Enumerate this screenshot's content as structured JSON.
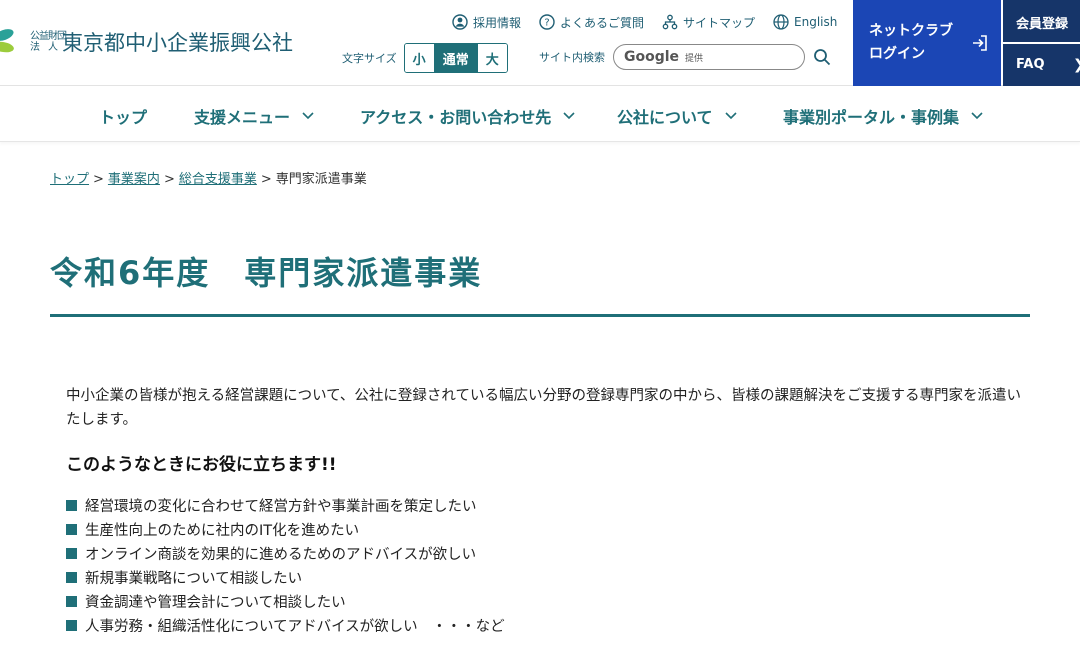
{
  "header": {
    "logo": {
      "corp_type": "公益財団\n法　人",
      "name": "東京都中小企業振興公社"
    },
    "util_links": [
      {
        "label": "採用情報",
        "icon": "person-circle-icon"
      },
      {
        "label": "よくあるご質問",
        "icon": "question-circle-icon"
      },
      {
        "label": "サイトマップ",
        "icon": "sitemap-icon"
      },
      {
        "label": "English",
        "icon": "globe-icon"
      }
    ],
    "font_size": {
      "label": "文字サイズ",
      "options": [
        "小",
        "通常",
        "大"
      ],
      "selected": "通常"
    },
    "search": {
      "label": "サイト内検索",
      "brand": "Google",
      "provided": "提供",
      "icon": "search-icon"
    },
    "netclub": {
      "label": "ネットクラブ\nログイン",
      "icon": "login-icon"
    },
    "member_register": "会員登録",
    "faq": "FAQ"
  },
  "gnav": {
    "items": [
      {
        "label": "トップ"
      },
      {
        "label": "支援メニュー"
      },
      {
        "label": "アクセス・お問い合わせ先"
      },
      {
        "label": "公社について"
      },
      {
        "label": "事業別ポータル・事例集"
      }
    ]
  },
  "breadcrumb": {
    "items": [
      "トップ",
      "事業案内",
      "総合支援事業"
    ],
    "current": "専門家派遣事業",
    "separator": ">"
  },
  "main": {
    "title": "令和6年度　専門家派遣事業",
    "intro": "中小企業の皆様が抱える経営課題について、公社に登録されている幅広い分野の登録専門家の中から、皆様の課題解決をご支援する専門家を派遣いたします。",
    "subheading": "このようなときにお役に立ちます!!",
    "bullets": [
      "経営環境の変化に合わせて経営方針や事業計画を策定したい",
      "生産性向上のために社内のIT化を進めたい",
      "オンライン商談を効果的に進めるためのアドバイスが欲しい",
      "新規事業戦略について相談したい",
      "資金調達や管理会計について相談したい",
      "人事労務・組織活性化についてアドバイスが欲しい　・・・など"
    ]
  },
  "colors": {
    "teal": "#1f6f78",
    "logo_text": "#1f5e73",
    "netclub_bg": "#1b46b5",
    "side_bg": "#163569"
  }
}
